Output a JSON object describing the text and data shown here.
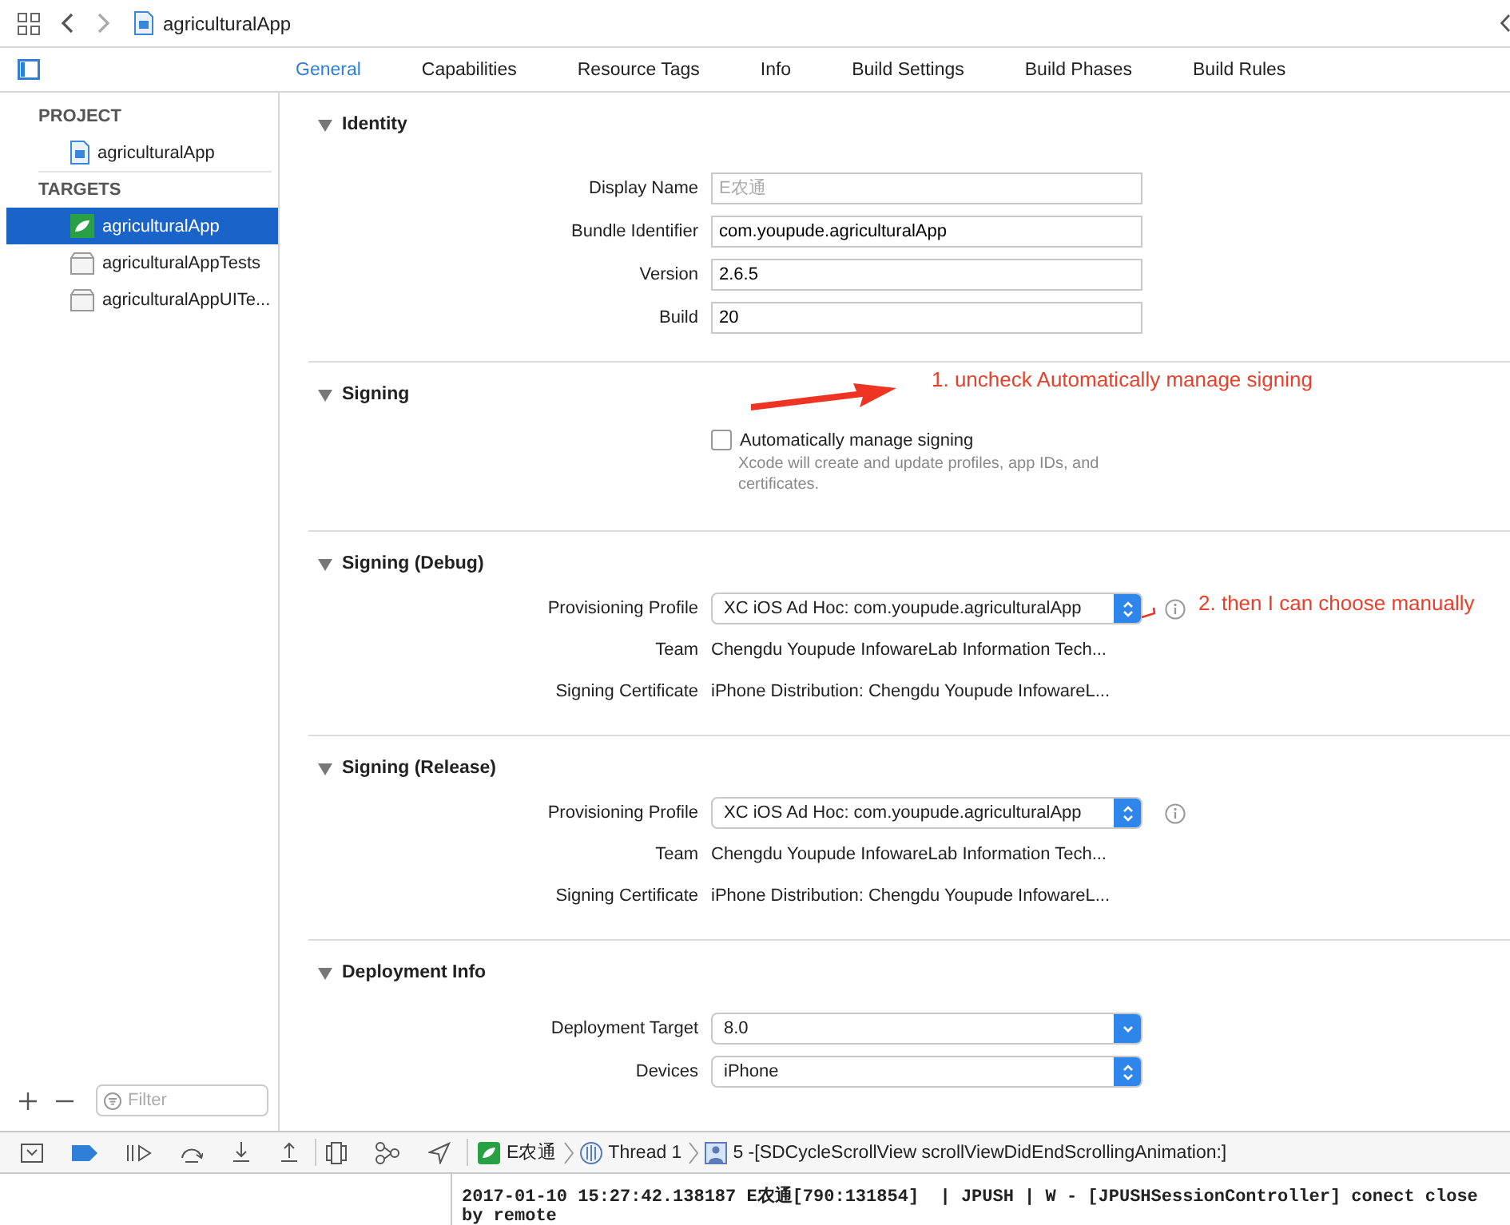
{
  "toolbar": {
    "title": "agriculturalApp"
  },
  "tabs": [
    {
      "label": "General",
      "selected": true
    },
    {
      "label": "Capabilities",
      "selected": false
    },
    {
      "label": "Resource Tags",
      "selected": false
    },
    {
      "label": "Info",
      "selected": false
    },
    {
      "label": "Build Settings",
      "selected": false
    },
    {
      "label": "Build Phases",
      "selected": false
    },
    {
      "label": "Build Rules",
      "selected": false
    }
  ],
  "sidebar": {
    "groups": [
      {
        "heading": "PROJECT",
        "items": [
          {
            "label": "agriculturalApp",
            "kind": "project",
            "selected": false
          }
        ]
      },
      {
        "heading": "TARGETS",
        "items": [
          {
            "label": "agriculturalApp",
            "kind": "app",
            "selected": true
          },
          {
            "label": "agriculturalAppTests",
            "kind": "bundle",
            "selected": false
          },
          {
            "label": "agriculturalAppUITe...",
            "kind": "bundle",
            "selected": false
          }
        ]
      }
    ],
    "filter": {
      "placeholder": "Filter"
    }
  },
  "sections": [
    {
      "title": "Identity",
      "expanded": true,
      "rows": [
        {
          "kind": "field",
          "label": "Display Name",
          "placeholder": "E农通"
        },
        {
          "kind": "field",
          "label": "Bundle Identifier",
          "value": "com.youpude.agriculturalApp"
        },
        {
          "kind": "field",
          "label": "Version",
          "value": "2.6.5"
        },
        {
          "kind": "field",
          "label": "Build",
          "value": "20"
        }
      ]
    },
    {
      "title": "Signing",
      "expanded": true,
      "rows": [
        {
          "kind": "checkbox",
          "label": "Automatically manage signing",
          "checked": false,
          "note": "Xcode will create and update profiles, app IDs, and certificates."
        }
      ],
      "annotation": "1. uncheck Automatically manage signing"
    },
    {
      "title": "Signing (Debug)",
      "expanded": true,
      "rows": [
        {
          "kind": "popup",
          "label": "Provisioning Profile",
          "value": "XC iOS Ad Hoc: com.youpude.agriculturalApp",
          "info": true
        },
        {
          "kind": "text",
          "label": "Team",
          "value": "Chengdu Youpude InfowareLab Information Tech..."
        },
        {
          "kind": "text",
          "label": "Signing Certificate",
          "value": "iPhone Distribution: Chengdu Youpude InfowareL..."
        }
      ],
      "annotation": "2. then I can choose manually"
    },
    {
      "title": "Signing (Release)",
      "expanded": true,
      "rows": [
        {
          "kind": "popup",
          "label": "Provisioning Profile",
          "value": "XC iOS Ad Hoc: com.youpude.agriculturalApp",
          "info": true
        },
        {
          "kind": "text",
          "label": "Team",
          "value": "Chengdu Youpude InfowareLab Information Tech..."
        },
        {
          "kind": "text",
          "label": "Signing Certificate",
          "value": "iPhone Distribution: Chengdu Youpude InfowareL..."
        }
      ]
    },
    {
      "title": "Deployment Info",
      "expanded": true,
      "rows": [
        {
          "kind": "pulldown",
          "label": "Deployment Target",
          "value": "8.0"
        },
        {
          "kind": "popup",
          "label": "Devices",
          "value": "iPhone"
        }
      ]
    }
  ],
  "debug_bar": {
    "app": "E农通",
    "thread": "Thread 1",
    "frame": "5 -[SDCycleScrollView scrollViewDidEndScrollingAnimation:]"
  },
  "console": {
    "lines": [
      "2017-01-10 15:27:42.138187 E农通[790:131854]  | JPUSH | W - [JPUSHSessionController] conect close",
      "by remote"
    ]
  }
}
